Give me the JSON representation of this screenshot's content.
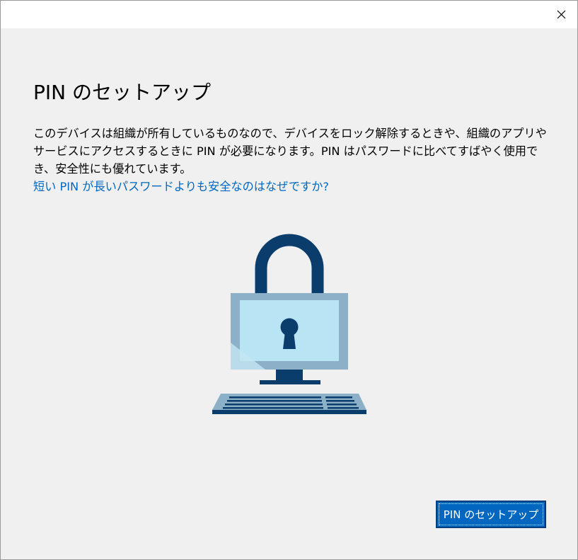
{
  "window": {
    "close_icon": "close-icon"
  },
  "content": {
    "title": "PIN のセットアップ",
    "description": "このデバイスは組織が所有しているものなので、デバイスをロック解除するときや、組織のアプリやサービスにアクセスするときに PIN が必要になります。PIN はパスワードに比べてすばやく使用でき、安全性にも優れています。",
    "help_link": "短い PIN が長いパスワードよりも安全なのはなぜですか?",
    "illustration_icon": "padlock-computer-icon"
  },
  "footer": {
    "setup_button_label": "PIN のセットアップ"
  },
  "colors": {
    "background": "#f0f0f0",
    "link": "#0067c0",
    "accent_button": "#0067c0",
    "lock_dark": "#0a3d6b",
    "monitor_frame": "#8cb0c8",
    "monitor_screen": "#b9e4f4"
  }
}
